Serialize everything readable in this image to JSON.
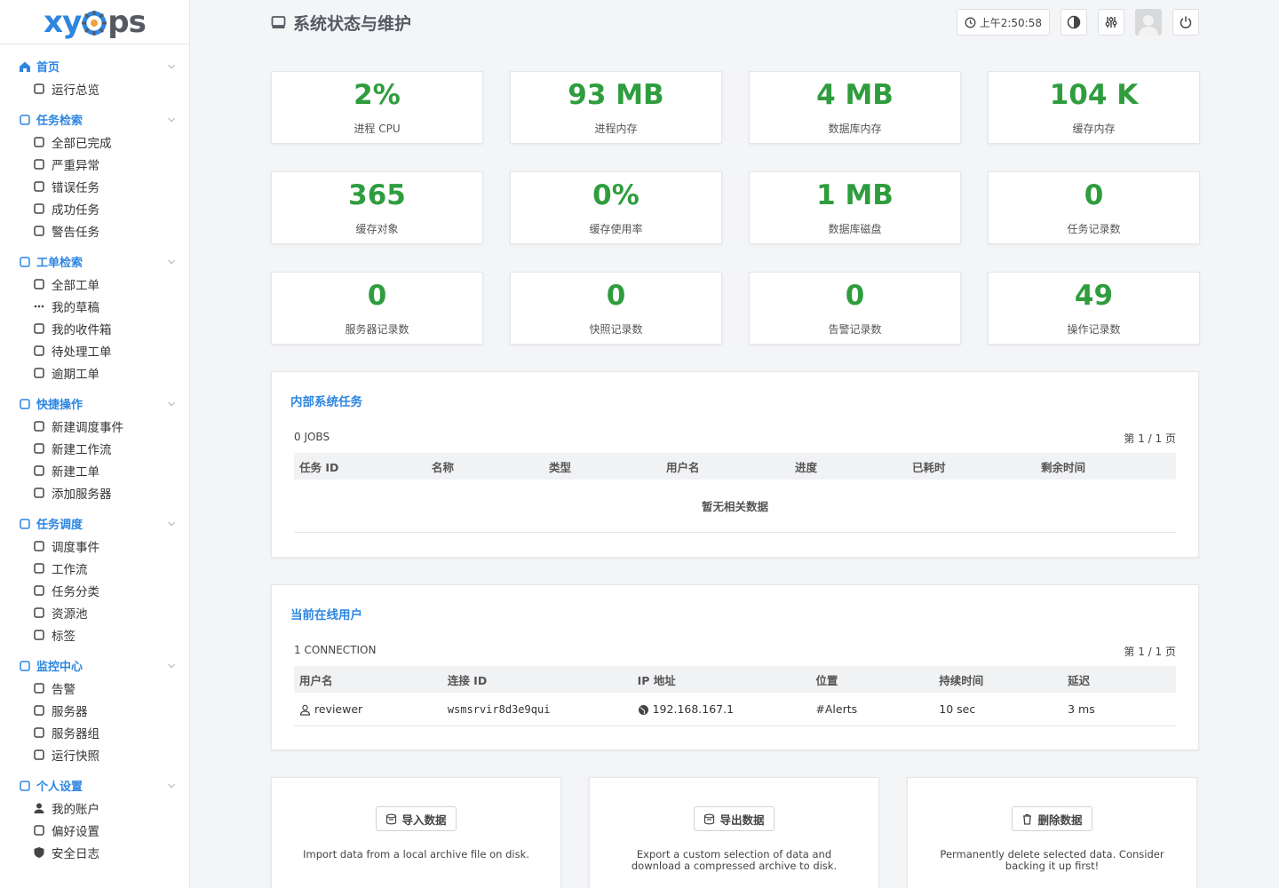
{
  "app": {
    "logo_main": "xy",
    "logo_tail": "ps"
  },
  "sidebar": {
    "sections": [
      {
        "title": "首页",
        "icon": "home-icon",
        "items": [
          {
            "label": "运行总览",
            "icon": "dashboard-icon"
          }
        ]
      },
      {
        "title": "任务检索",
        "icon": "user-search-icon",
        "items": [
          {
            "label": "全部已完成",
            "icon": "cloud-check-icon"
          },
          {
            "label": "严重异常",
            "icon": "fire-icon"
          },
          {
            "label": "错误任务",
            "icon": "alert-circle-icon"
          },
          {
            "label": "成功任务",
            "icon": "check-circle-icon"
          },
          {
            "label": "警告任务",
            "icon": "warning-triangle-icon"
          }
        ]
      },
      {
        "title": "工单检索",
        "icon": "ticket-search-icon",
        "items": [
          {
            "label": "全部工单",
            "icon": "list-doc-icon"
          },
          {
            "label": "我的草稿",
            "icon": "dots-icon"
          },
          {
            "label": "我的收件箱",
            "icon": "mail-icon"
          },
          {
            "label": "待处理工单",
            "icon": "tag-outline-icon"
          },
          {
            "label": "逾期工单",
            "icon": "calendar-icon"
          }
        ]
      },
      {
        "title": "快捷操作",
        "icon": "thumb-icon",
        "items": [
          {
            "label": "新建调度事件",
            "icon": "calendar-edit-icon"
          },
          {
            "label": "新建工作流",
            "icon": "workflow-add-icon"
          },
          {
            "label": "新建工单",
            "icon": "ticket-add-icon"
          },
          {
            "label": "添加服务器",
            "icon": "server-add-icon"
          }
        ]
      },
      {
        "title": "任务调度",
        "icon": "calendar-clock-icon",
        "items": [
          {
            "label": "调度事件",
            "icon": "calendar-clock-icon"
          },
          {
            "label": "工作流",
            "icon": "workflow-icon"
          },
          {
            "label": "任务分类",
            "icon": "folder-icon"
          },
          {
            "label": "资源池",
            "icon": "pool-icon"
          },
          {
            "label": "标签",
            "icon": "tags-icon"
          }
        ]
      },
      {
        "title": "监控中心",
        "icon": "camera-icon",
        "items": [
          {
            "label": "告警",
            "icon": "alarm-icon"
          },
          {
            "label": "服务器",
            "icon": "server-icon"
          },
          {
            "label": "服务器组",
            "icon": "server-group-icon"
          },
          {
            "label": "运行快照",
            "icon": "monitor-icon"
          }
        ]
      },
      {
        "title": "个人设置",
        "icon": "settings-icon",
        "items": [
          {
            "label": "我的账户",
            "icon": "account-icon"
          },
          {
            "label": "偏好设置",
            "icon": "sliders-icon"
          },
          {
            "label": "安全日志",
            "icon": "shield-icon"
          }
        ]
      }
    ]
  },
  "header": {
    "title": "系统状态与维护",
    "clock": "上午2:50:58"
  },
  "stats": [
    {
      "value": "2%",
      "label": "进程 CPU"
    },
    {
      "value": "93 MB",
      "label": "进程内存"
    },
    {
      "value": "4 MB",
      "label": "数据库内存"
    },
    {
      "value": "104 K",
      "label": "缓存内存"
    },
    {
      "value": "365",
      "label": "缓存对象"
    },
    {
      "value": "0%",
      "label": "缓存使用率"
    },
    {
      "value": "1 MB",
      "label": "数据库磁盘"
    },
    {
      "value": "0",
      "label": "任务记录数"
    },
    {
      "value": "0",
      "label": "服务器记录数"
    },
    {
      "value": "0",
      "label": "快照记录数"
    },
    {
      "value": "0",
      "label": "告警记录数"
    },
    {
      "value": "49",
      "label": "操作记录数"
    }
  ],
  "jobs_panel": {
    "title": "内部系统任务",
    "count": "0 JOBS",
    "pagination": "第 1 / 1 页",
    "columns": [
      "任务 ID",
      "名称",
      "类型",
      "用户名",
      "进度",
      "已耗时",
      "剩余时间"
    ],
    "empty": "暂无相关数据"
  },
  "users_panel": {
    "title": "当前在线用户",
    "count": "1 CONNECTION",
    "pagination": "第 1 / 1 页",
    "columns": [
      "用户名",
      "连接 ID",
      "IP 地址",
      "位置",
      "持续时间",
      "延迟"
    ],
    "rows": [
      {
        "username": "reviewer",
        "conn_id": "wsmsrvir8d3e9qui",
        "ip": "192.168.167.1",
        "location": "#Alerts",
        "duration": "10 sec",
        "latency": "3 ms"
      }
    ]
  },
  "cards": [
    {
      "button": "导入数据",
      "icon": "import-icon",
      "desc": "Import data from a local archive file on disk."
    },
    {
      "button": "导出数据",
      "icon": "export-icon",
      "desc": "Export a custom selection of data and download a compressed archive to disk."
    },
    {
      "button": "删除数据",
      "icon": "trash-icon",
      "desc": "Permanently delete selected data. Consider backing it up first!"
    }
  ]
}
